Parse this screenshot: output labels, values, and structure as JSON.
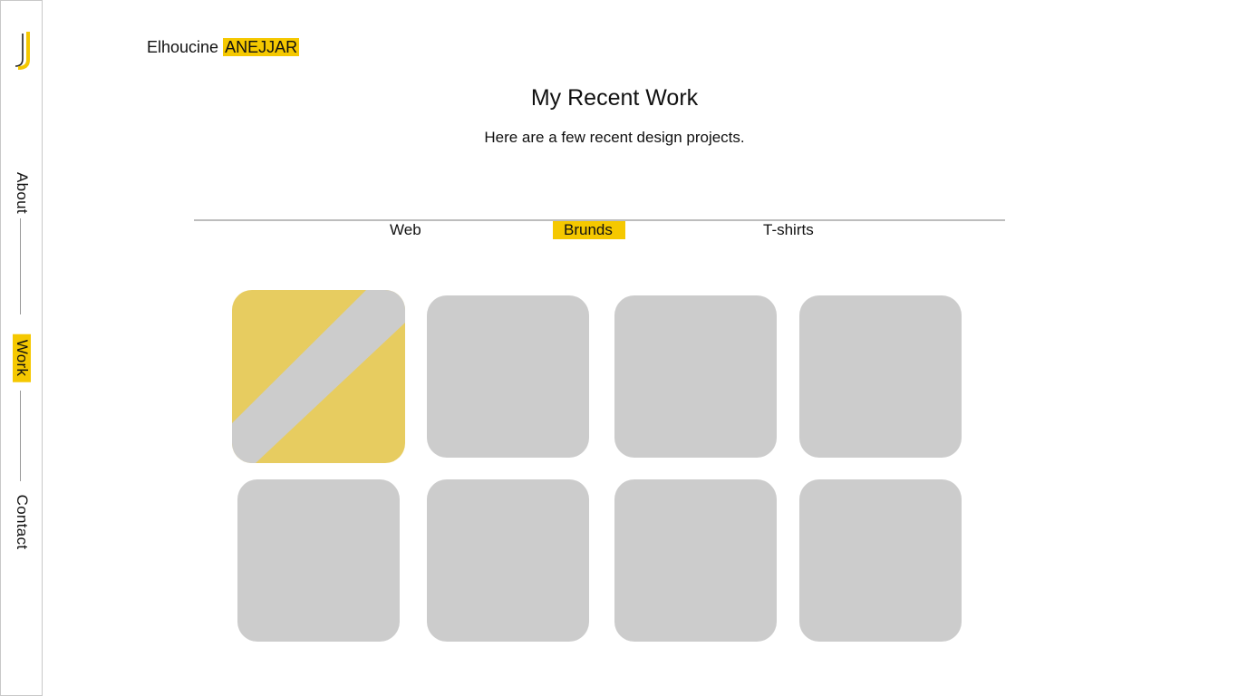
{
  "brand": {
    "first_name": "Elhoucine",
    "last_name": "ANEJJAR",
    "logo_icon": "j-monogram-icon",
    "accent_color": "#f5c800"
  },
  "sidebar": {
    "items": [
      {
        "label": "About",
        "active": false
      },
      {
        "label": "Work",
        "active": true
      },
      {
        "label": "Contact",
        "active": false
      }
    ]
  },
  "section": {
    "title": "My Recent Work",
    "subtitle": "Here are a few recent design projects."
  },
  "tabs": [
    {
      "label": "Web",
      "active": false
    },
    {
      "label": "Brunds",
      "active": true
    },
    {
      "label": "T-shirts",
      "active": false
    }
  ],
  "grid": {
    "placeholder_color": "#cccccc",
    "featured_color": "#e7cc60",
    "card_count": 8
  }
}
